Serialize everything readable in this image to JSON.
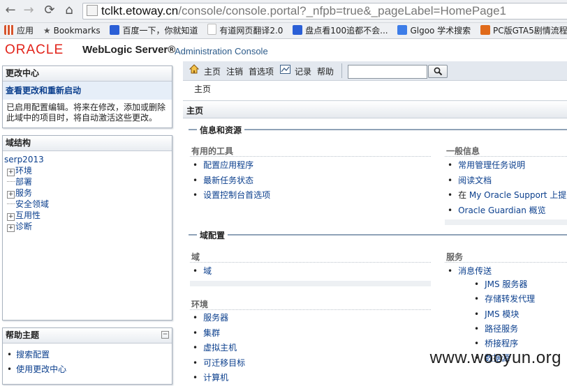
{
  "browser": {
    "url_host": "tclkt.etoway.cn",
    "url_path": "/console/console.portal?_nfpb=true&_pageLabel=HomePage1",
    "bookmarks": [
      {
        "label": "应用",
        "color": "#d6542c"
      },
      {
        "label": "Bookmarks",
        "color": "#777777"
      },
      {
        "label": "百度一下，你就知道",
        "color": "#2b5fd6"
      },
      {
        "label": "有道网页翻译2.0",
        "color": "#bbbbbb"
      },
      {
        "label": "盘点看100追都不会...",
        "color": "#2b5fd6"
      },
      {
        "label": "Glgoo 学术搜索",
        "color": "#3d7de8"
      },
      {
        "label": "PC版GTA5剧情流程",
        "color": "#e06a1a"
      }
    ]
  },
  "brand": {
    "oracle": "ORACLE",
    "product": "WebLogic Server®",
    "console": "Administration Console"
  },
  "change_center": {
    "title": "更改中心",
    "link": "查看更改和重新启动",
    "text": "已启用配置编辑。将来在修改，添加或删除此域中的项目时，将自动激活这些更改。"
  },
  "domain_structure": {
    "title": "域结构",
    "root": "serp2013",
    "nodes": [
      {
        "label": "环境",
        "expandable": true
      },
      {
        "label": "部署",
        "expandable": false
      },
      {
        "label": "服务",
        "expandable": true
      },
      {
        "label": "安全领域",
        "expandable": false
      },
      {
        "label": "互用性",
        "expandable": true
      },
      {
        "label": "诊断",
        "expandable": true
      }
    ]
  },
  "help_topics": {
    "title": "帮助主题",
    "collapse": "−",
    "items": [
      "搜索配置",
      "使用更改中心"
    ]
  },
  "topnav": {
    "home": "主页",
    "logout": "注销",
    "preferences": "首选项",
    "record": "记录",
    "help": "帮助",
    "search_value": ""
  },
  "breadcrumb": "主页",
  "content_title": "主页",
  "info_section": {
    "title": "信息和资源",
    "tools_title": "有用的工具",
    "tools": [
      "配置应用程序",
      "最新任务状态",
      "设置控制台首选项"
    ],
    "general_title": "一般信息",
    "general": [
      {
        "text": "常用管理任务说明"
      },
      {
        "text": "阅读文档"
      },
      {
        "prefix": "在 ",
        "link": "My Oracle Support",
        "suffix": " 上提问"
      },
      {
        "link": "Oracle Guardian",
        "suffix": " 概览"
      }
    ]
  },
  "domain_section": {
    "title": "域配置",
    "domain_title": "域",
    "domain_items": [
      "域"
    ],
    "env_title": "环境",
    "env_items": [
      "服务器",
      "集群",
      "虚拟主机",
      "可迁移目标",
      "计算机"
    ],
    "services_title": "服务",
    "services_items": [
      "消息传送"
    ],
    "messaging_items": [
      "JMS 服务器",
      "存储转发代理",
      "JMS 模块",
      "路径服务",
      "桥接程序",
      "数据源"
    ]
  },
  "watermark": "www.wooyun.org"
}
